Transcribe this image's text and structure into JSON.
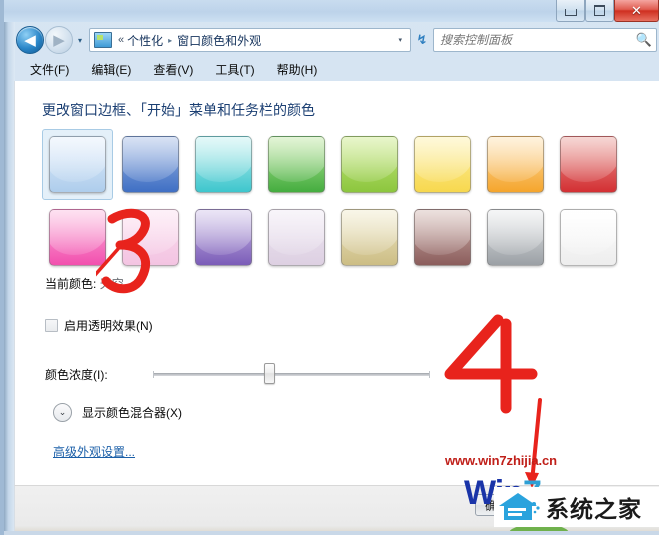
{
  "window": {
    "buttons": {
      "minimize": "minimize",
      "maximize": "maximize",
      "close": "✕"
    }
  },
  "navbar": {
    "back_glyph": "◀",
    "forward_glyph": "▶",
    "history_glyph": "▾",
    "breadcrumb": {
      "overflow": "«",
      "items": [
        "个性化",
        "窗口颜色和外观"
      ],
      "arrow": "▸"
    },
    "dropdown_glyph": "▾",
    "refresh_glyph": "↯",
    "search": {
      "placeholder": "搜索控制面板",
      "value": "",
      "icon": "search-icon"
    }
  },
  "menubar": {
    "items": [
      "文件(F)",
      "编辑(E)",
      "查看(V)",
      "工具(T)",
      "帮助(H)"
    ]
  },
  "content": {
    "heading": "更改窗口边框、「开始」菜单和任务栏的颜色",
    "swatch_rows": [
      [
        {
          "name": "天空",
          "selected": true,
          "top": "#e2eefb",
          "bottom": "#aecdec"
        },
        {
          "name": "蓝色",
          "selected": false,
          "top": "#9fb8e4",
          "bottom": "#3f6fc4"
        },
        {
          "name": "青色",
          "selected": false,
          "top": "#bdefef",
          "bottom": "#3ec6cd"
        },
        {
          "name": "绿色",
          "selected": false,
          "top": "#b9e59a",
          "bottom": "#44ad3f"
        },
        {
          "name": "橄榄",
          "selected": false,
          "top": "#c7e87f",
          "bottom": "#8cc63e"
        },
        {
          "name": "黄色",
          "selected": false,
          "top": "#fdf0a4",
          "bottom": "#f7d84e"
        },
        {
          "name": "橙色",
          "selected": false,
          "top": "#fde0ad",
          "bottom": "#f5a52c"
        },
        {
          "name": "红色",
          "selected": false,
          "top": "#e99b95",
          "bottom": "#d32f33"
        }
      ],
      [
        {
          "name": "粉红",
          "selected": false,
          "top": "#fbb6dd",
          "bottom": "#f24fae"
        },
        {
          "name": "玫瑰",
          "selected": false,
          "top": "#fbdcee",
          "bottom": "#f3c4e2"
        },
        {
          "name": "紫色",
          "selected": false,
          "top": "#cec0e8",
          "bottom": "#7b5cb8"
        },
        {
          "name": "淡紫",
          "selected": false,
          "top": "#eee6f2",
          "bottom": "#ddd0e2"
        },
        {
          "name": "褐色",
          "selected": false,
          "top": "#efe8c7",
          "bottom": "#ccbd84"
        },
        {
          "name": "深褐",
          "selected": false,
          "top": "#d0b3ad",
          "bottom": "#8b5d5c"
        },
        {
          "name": "石墨",
          "selected": false,
          "top": "#e6e8ea",
          "bottom": "#9ba0a5"
        },
        {
          "name": "白色",
          "selected": false,
          "top": "#ffffff",
          "bottom": "#ededed"
        }
      ]
    ],
    "current_color_label": "当前颜色:",
    "current_color_value": "天空",
    "transparency": {
      "label": "启用透明效果(N)",
      "checked": false
    },
    "intensity": {
      "label": "颜色浓度(I):",
      "value_percent": 42
    },
    "mixer": {
      "label": "显示颜色混合器(X)",
      "chevron": "⌄"
    },
    "advanced_link": "高级外观设置..."
  },
  "footer": {
    "ok_label": "确定"
  },
  "annotations": {
    "marker_color": "#e8231c",
    "items": [
      {
        "label": "3",
        "points_to": "当前颜色: 天空"
      },
      {
        "label": "4",
        "points_to": "确定"
      }
    ]
  },
  "watermark": {
    "url": "www.win7zhijia.cn",
    "brand_win": "Win",
    "brand_suffix": "7",
    "logo_text": "系统之家"
  }
}
